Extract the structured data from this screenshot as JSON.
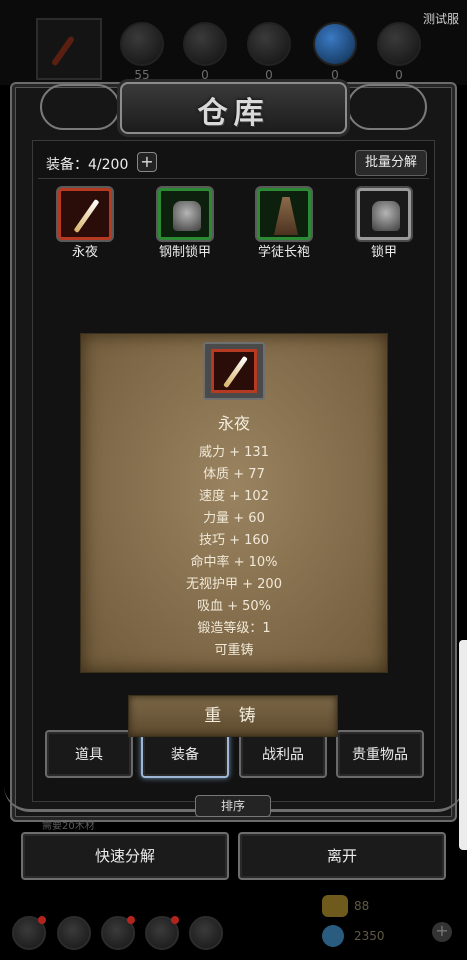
{
  "header": {
    "test_server": "测试服",
    "resources": [
      {
        "name": "wood-resource-icon",
        "value": "55"
      },
      {
        "name": "leather-resource-icon",
        "value": "0"
      },
      {
        "name": "cloth-resource-icon",
        "value": "0"
      },
      {
        "name": "metal-resource-icon",
        "value": "0"
      },
      {
        "name": "crystal-resource-icon",
        "value": "0"
      },
      {
        "name": "ore-resource-icon",
        "value": "0"
      }
    ]
  },
  "warehouse": {
    "title": "仓库",
    "equip_count": "装备：4/200",
    "add_label": "+",
    "batch_label": "批量分解"
  },
  "items": [
    {
      "label": "永夜",
      "rarity": "red"
    },
    {
      "label": "钢制锁甲",
      "rarity": "green"
    },
    {
      "label": "学徒长袍",
      "rarity": "green"
    },
    {
      "label": "锁甲",
      "rarity": "gray"
    }
  ],
  "detail": {
    "name": "永夜",
    "stats": [
      "威力 + 131",
      "体质 + 77",
      "速度 + 102",
      "力量 + 60",
      "技巧 + 160",
      "命中率 + 10%",
      "无视护甲 + 200",
      "吸血 + 50%",
      "锻造等级：1",
      "可重铸"
    ],
    "reforge_label": "重 铸"
  },
  "tabs": [
    {
      "label": "道具"
    },
    {
      "label": "装备"
    },
    {
      "label": "战利品"
    },
    {
      "label": "贵重物品"
    }
  ],
  "sort_label": "排序",
  "need_wood": "需要20木材",
  "actions": {
    "quick_label": "快速分解",
    "leave_label": "离开"
  },
  "footer": {
    "gold": "88",
    "gems": "2350",
    "plus": "+"
  },
  "colors": {
    "red_rarity": "#b63a22",
    "green_rarity": "#2c8a34",
    "gray_rarity": "#9a9a9a",
    "parchment": "#8d7650"
  }
}
